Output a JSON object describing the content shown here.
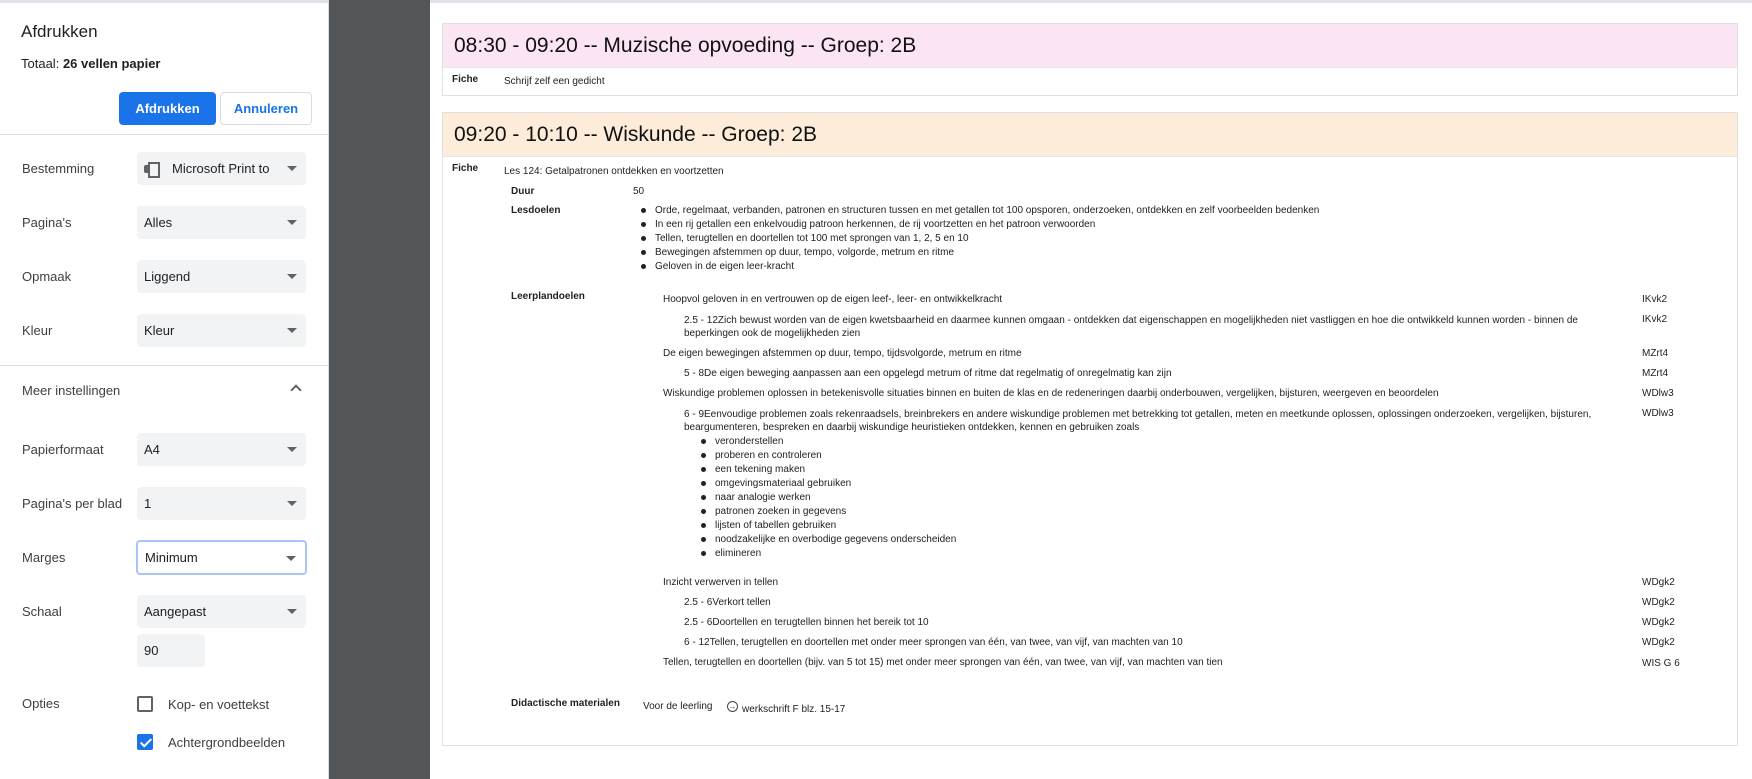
{
  "dialog": {
    "title": "Afdrukken",
    "total_label": "Totaal:",
    "total_value": "26 vellen papier",
    "print_button": "Afdrukken",
    "cancel_button": "Annuleren",
    "settings": {
      "destination": {
        "label": "Bestemming",
        "value": "Microsoft Print to",
        "icon": "printer-icon"
      },
      "pages": {
        "label": "Pagina's",
        "value": "Alles"
      },
      "layout": {
        "label": "Opmaak",
        "value": "Liggend"
      },
      "color": {
        "label": "Kleur",
        "value": "Kleur"
      }
    },
    "more_settings": {
      "label": "Meer instellingen",
      "icon": "chevron-up-icon"
    },
    "more": {
      "paper_size": {
        "label": "Papierformaat",
        "value": "A4"
      },
      "pages_per_sheet": {
        "label": "Pagina's per blad",
        "value": "1"
      },
      "margins": {
        "label": "Marges",
        "value": "Minimum"
      },
      "scale": {
        "label": "Schaal",
        "value": "Aangepast",
        "custom_value": "90"
      },
      "options": {
        "label": "Opties",
        "header_footer": {
          "label": "Kop- en voettekst",
          "checked": false
        },
        "background": {
          "label": "Achtergrondbeelden",
          "checked": true
        }
      }
    },
    "colors": {
      "accent": "#1a73e8",
      "gutter": "#525659"
    }
  },
  "preview": {
    "card1": {
      "title": "08:30 - 09:20 -- Muzische opvoeding -- Groep: 2B",
      "header_color": "#fbe4f4",
      "fiche_label": "Fiche",
      "fiche_text": "Schrijf zelf een gedicht"
    },
    "card2": {
      "title": "09:20 - 10:10 -- Wiskunde -- Groep: 2B",
      "header_color": "#fdecd9",
      "fiche_label": "Fiche",
      "fiche_text": "Les 124: Getalpatronen ontdekken en voortzetten",
      "duur_label": "Duur",
      "duur_value": "50",
      "lesdoelen_label": "Lesdoelen",
      "lesdoelen": [
        "Orde, regelmaat, verbanden, patronen en structuren tussen en met getallen tot 100 opsporen, onderzoeken, ontdekken en zelf voorbeelden bedenken",
        "In een rij getallen een enkelvoudig patroon herkennen, de rij voortzetten en het patroon verwoorden",
        "Tellen, terugtellen en doortellen tot 100 met sprongen van 1, 2, 5 en 10",
        "Bewegingen afstemmen op duur, tempo, volgorde, metrum en ritme",
        "Geloven in de eigen leer-kracht"
      ],
      "leerplandoelen_label": "Leerplandoelen",
      "leerplandoelen": [
        {
          "text": "Hoopvol geloven in en vertrouwen op de eigen leef-, leer- en ontwikkelkracht",
          "code": "IKvk2"
        },
        {
          "text": "2.5 - 12Zich bewust worden van de eigen kwetsbaarheid en daarmee kunnen omgaan - ontdekken dat eigenschappen en mogelijkheden niet vastliggen en hoe die ontwikkeld kunnen worden - binnen de beperkingen ook de mogelijkheden zien",
          "code": "IKvk2"
        },
        {
          "text": "De eigen bewegingen afstemmen op duur, tempo, tijdsvolgorde, metrum en ritme",
          "code": "MZrt4"
        },
        {
          "text": "5 - 8De eigen beweging aanpassen aan een opgelegd metrum of ritme dat regelmatig of onregelmatig kan zijn",
          "code": "MZrt4"
        },
        {
          "text": "Wiskundige problemen oplossen in betekenisvolle situaties binnen en buiten de klas en de redeneringen daarbij onderbouwen, vergelijken, bijsturen, weergeven en beoordelen",
          "code": "WDlw3"
        },
        {
          "text": "6 - 9Eenvoudige problemen zoals rekenraadsels, breinbrekers en andere wiskundige problemen met betrekking tot getallen, meten en meetkunde oplossen, oplossingen onderzoeken, vergelijken, bijsturen, beargumenteren, bespreken en daarbij wiskundige heuristieken ontdekken, kennen en gebruiken zoals",
          "code": "WDlw3"
        },
        {
          "text": "Inzicht verwerven in tellen",
          "code": "WDgk2"
        },
        {
          "text": "2.5 - 6Verkort tellen",
          "code": "WDgk2"
        },
        {
          "text": "2.5 - 6Doortellen en terugtellen binnen het bereik tot 10",
          "code": "WDgk2"
        },
        {
          "text": "6 - 12Tellen, terugtellen en doortellen met onder meer sprongen van één, van twee, van vijf, van machten van 10",
          "code": "WDgk2"
        },
        {
          "text": "Tellen, terugtellen en doortellen (bijv. van 5 tot 15) met onder meer sprongen van één, van twee, van vijf, van machten van tien",
          "code": "WIS G 6"
        }
      ],
      "heuristieken": [
        "veronderstellen",
        "proberen en controleren",
        "een tekening maken",
        "omgevingsmateriaal gebruiken",
        "naar analogie werken",
        "patronen zoeken in gegevens",
        "lijsten of tabellen gebruiken",
        "noodzakelijke en overbodige gegevens onderscheiden",
        "elimineren"
      ],
      "materials_label": "Didactische materialen",
      "materials_for": "Voor de leerling",
      "materials_item": "werkschrift F blz. 15-17",
      "materials_icon": "circle-arrow-icon"
    }
  }
}
